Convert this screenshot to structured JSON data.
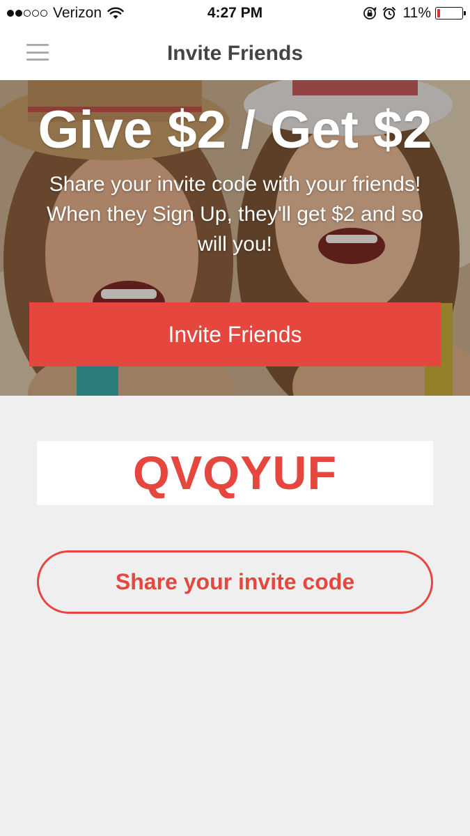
{
  "status_bar": {
    "carrier": "Verizon",
    "signal_bars_filled": 2,
    "signal_bars_total": 5,
    "time": "4:27 PM",
    "battery_percent": "11%",
    "battery_level": 0.11,
    "battery_color": "#e03030"
  },
  "nav": {
    "title": "Invite Friends",
    "menu_icon": "hamburger-menu-icon"
  },
  "hero": {
    "title": "Give $2 / Get $2",
    "description": "Share your invite code with your friends! When they Sign Up, they'll get $2 and so will you!",
    "invite_button_label": "Invite Friends"
  },
  "invite": {
    "code": "QVQYUF",
    "share_button_label": "Share your invite code"
  },
  "colors": {
    "accent": "#e5463d",
    "background": "#efefef"
  }
}
